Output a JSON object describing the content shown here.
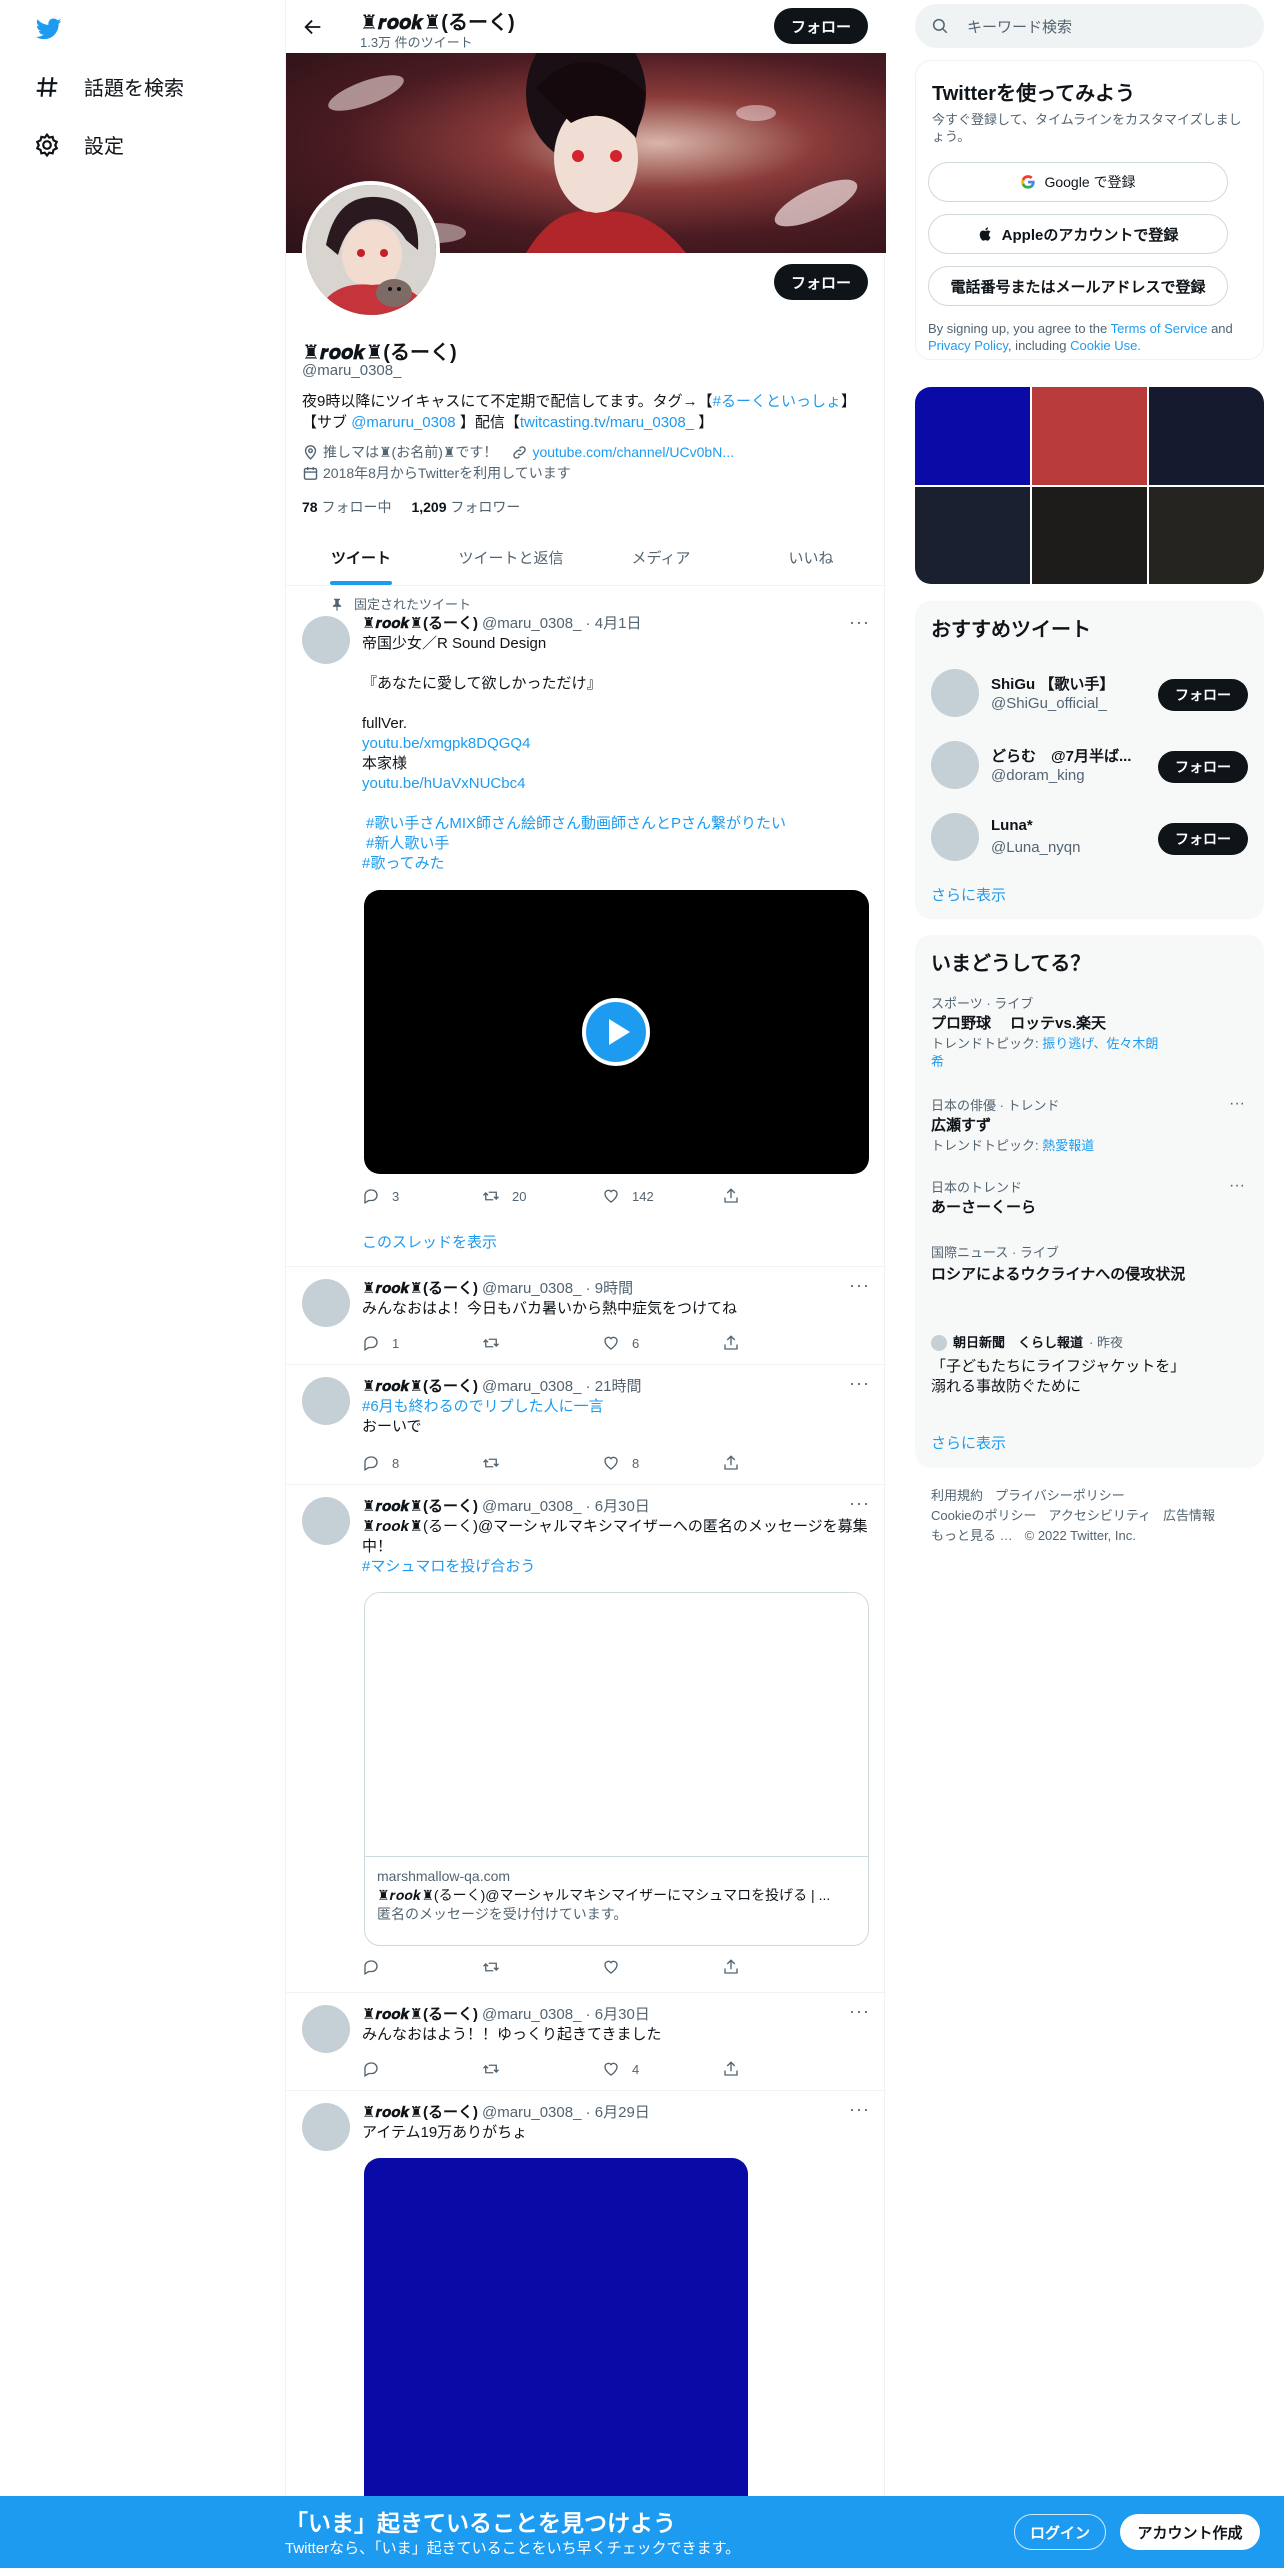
{
  "nav": {
    "explore_label": "話題を検索",
    "settings_label": "設定"
  },
  "profile": {
    "name": "♜𝒓𝒐𝒐𝒌♜(るーく)",
    "tweet_count": "1.3万 件のツイート",
    "follow_label": "フォロー",
    "handle": "@maru_0308_",
    "bio_line1_pre": "夜9時以降にツイキャスにて不定期で配信してます。タグ→【",
    "bio_line1_tag": "#るーくといっしょ",
    "bio_line1_post": "】",
    "bio_line2_pre": "【サブ",
    "bio_line2_mention": "@maruru_0308",
    "bio_line2_mid": "】配信【",
    "bio_line2_link": "twitcasting.tv/maru_0308_",
    "bio_line2_post": "】",
    "location": "推しマは♜(お名前)♜です！",
    "url": "youtube.com/channel/UCv0bN...",
    "joined": "2018年8月からTwitterを利用しています",
    "following_count": "78",
    "following_label": "フォロー中",
    "followers_count": "1,209",
    "followers_label": "フォロワー"
  },
  "tabs": [
    "ツイート",
    "ツイートと返信",
    "メディア",
    "いいね"
  ],
  "pinned_label": "固定されたツイート",
  "tweets": [
    {
      "name": "♜𝒓𝒐𝒐𝒌♜(るーく)",
      "meta": "@maru_0308_ · 4月1日",
      "lines": [
        "帝国少女／R Sound Design",
        "",
        "『あなたに愛して欲しかっただけ』",
        "",
        "fullVer."
      ],
      "link1": "youtu.be/xmgpk8DQGQ4",
      "line_mid": "本家様",
      "link2": "youtu.be/hUaVxNUCbc4",
      "tags": [
        "#歌い手さんMIX師さん絵師さん動画師さんとPさん繋がりたい",
        "#新人歌い手",
        "#歌ってみた"
      ],
      "reply": "3",
      "retweet": "20",
      "like": "142",
      "thread_label": "このスレッドを表示"
    },
    {
      "name": "♜𝒓𝒐𝒐𝒌♜(るーく)",
      "meta": "@maru_0308_ · 9時間",
      "text": "みんなおはよ！今日もバカ暑いから熱中症気をつけてね",
      "reply": "1",
      "retweet": "",
      "like": "6"
    },
    {
      "name": "♜𝒓𝒐𝒐𝒌♜(るーく)",
      "meta": "@maru_0308_ · 21時間",
      "tag": "#6月も終わるのでリプした人に一言",
      "text": "おーいで",
      "reply": "8",
      "retweet": "",
      "like": "8"
    },
    {
      "name": "♜𝒓𝒐𝒐𝒌♜(るーく)",
      "meta": "@maru_0308_ · 6月30日",
      "text": "♜𝒓𝒐𝒐𝒌♜(るーく)@マーシャルマキシマイザーへの匿名のメッセージを募集中！",
      "tag": "#マシュマロを投げ合おう",
      "card_domain": "marshmallow-qa.com",
      "card_title": "♜𝒓𝒐𝒐𝒌♜(るーく)@マーシャルマキシマイザーにマシュマロを投げる | ...",
      "card_desc": "匿名のメッセージを受け付けています。"
    },
    {
      "name": "♜𝒓𝒐𝒐𝒌♜(るーく)",
      "meta": "@maru_0308_ · 6月30日",
      "text": "みんなおはよう！！ゆっくり起きてきました",
      "reply": "",
      "retweet": "",
      "like": "4"
    },
    {
      "name": "♜𝒓𝒐𝒐𝒌♜(るーく)",
      "meta": "@maru_0308_ · 6月29日",
      "text": "アイテム19万ありがちょ"
    }
  ],
  "right": {
    "search_placeholder": "キーワード検索",
    "signup_title": "Twitterを使ってみよう",
    "signup_sub": "今すぐ登録して、タイムラインをカスタマイズしましょう。",
    "google_btn": "Google で登録",
    "apple_btn": "Appleのアカウントで登録",
    "phone_btn": "電話番号またはメールアドレスで登録",
    "terms_pre": "By signing up, you agree to the",
    "terms_tos": "Terms of Service",
    "terms_and": "and",
    "terms_privacy": "Privacy Policy",
    "terms_incl": ", including",
    "terms_cookie": "Cookie Use.",
    "media_colors": [
      "#0a0aa6",
      "#b83a3a",
      "#151a2e",
      "#1a2030",
      "#1e1c1a",
      "#262420"
    ],
    "recommend_title": "おすすめツイート",
    "recommend": [
      {
        "name": "ShiGu 【歌い手】",
        "handle": "@ShiGu_official_",
        "btn": "フォロー"
      },
      {
        "name": "どらむ　@7月半ば...",
        "handle": "@doram_king",
        "btn": "フォロー"
      },
      {
        "name": "Luna*",
        "handle": "@Luna_nyqn",
        "btn": "フォロー"
      }
    ],
    "show_more": "さらに表示",
    "trends_title": "いまどうしてる？",
    "trends": [
      {
        "cat": "スポーツ · ライブ",
        "title": "プロ野球　 ロッテvs.楽天",
        "sub_pre": "トレンドトピック:",
        "sub_links": "振り逃げ、佐々木朗希"
      },
      {
        "cat": "日本の俳優 · トレンド",
        "title": "広瀬すず",
        "sub_pre": "トレンドトピック:",
        "sub_links": "熱愛報道"
      },
      {
        "cat": "日本のトレンド",
        "title": "あーさーくーら"
      },
      {
        "cat": "国際ニュース · ライブ",
        "title": "ロシアによるウクライナへの侵攻状況"
      }
    ],
    "news_source": "朝日新聞　くらし報道",
    "news_time": "· 昨夜",
    "news_title": "「子どもたちにライフジャケットを」　溺れる事故防ぐために",
    "trends_more": "さらに表示",
    "footer_line1": [
      "利用規約",
      "プライバシーポリシー"
    ],
    "footer_line2": [
      "Cookieのポリシー",
      "アクセシビリティ",
      "広告情報"
    ],
    "footer_line3": [
      "もっと見る …",
      "© 2022 Twitter, Inc."
    ]
  },
  "bottom": {
    "title": "「いま」起きていることを見つけよう",
    "sub": "Twitterなら、「いま」起きていることをいち早くチェックできます。",
    "login": "ログイン",
    "signup": "アカウント作成"
  }
}
